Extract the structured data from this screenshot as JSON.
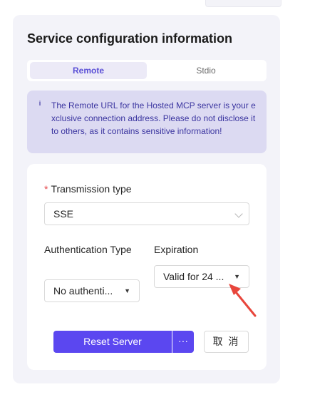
{
  "panel": {
    "title": "Service configuration information"
  },
  "tabs": [
    {
      "label": "Remote",
      "active": true
    },
    {
      "label": "Stdio",
      "active": false
    }
  ],
  "notice": {
    "icon": "info-icon",
    "text": "The Remote URL for the Hosted MCP server is your exclusive connection address. Please do not disclose it to others, as it contains sensitive information!"
  },
  "form": {
    "transmission": {
      "required_mark": "*",
      "label": "Transmission type",
      "value": "SSE"
    },
    "authentication": {
      "label": "Authentication Type",
      "value": "No authenti..."
    },
    "expiration": {
      "label": "Expiration",
      "value": "Valid for 24 ..."
    }
  },
  "actions": {
    "reset_label": "Reset Server",
    "more_label": "···",
    "cancel_label": "取 消"
  },
  "colors": {
    "primary": "#5b47f0",
    "accent_text": "#5a4fd6",
    "notice_bg": "#dcdaf2",
    "required": "#e5484d",
    "annotation_arrow": "#e8463c"
  }
}
